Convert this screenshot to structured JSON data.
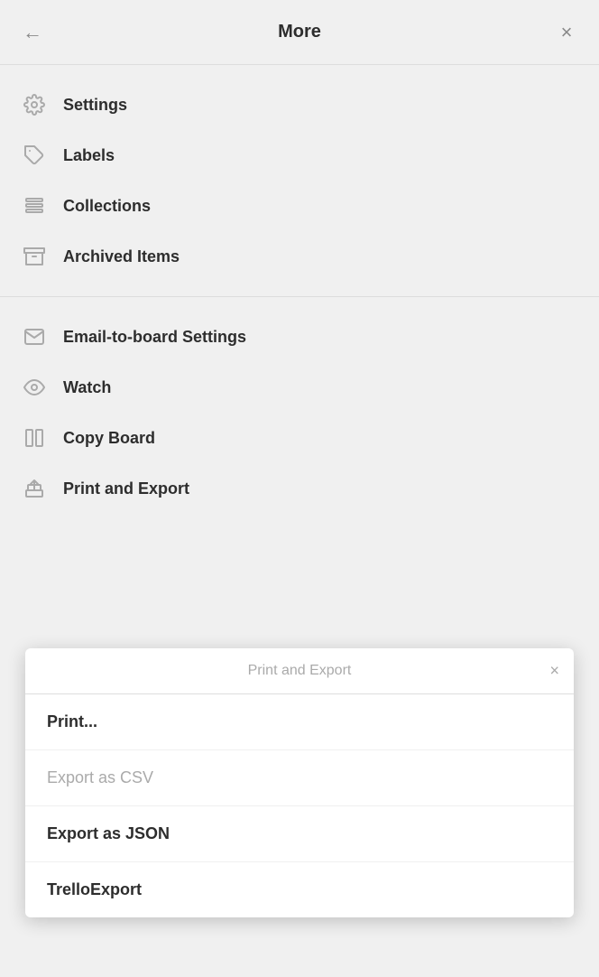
{
  "header": {
    "back_label": "←",
    "title": "More",
    "close_label": "×"
  },
  "section1": {
    "items": [
      {
        "id": "settings",
        "label": "Settings",
        "icon": "gear-icon"
      },
      {
        "id": "labels",
        "label": "Labels",
        "icon": "label-icon"
      },
      {
        "id": "collections",
        "label": "Collections",
        "icon": "collections-icon"
      },
      {
        "id": "archived-items",
        "label": "Archived Items",
        "icon": "archive-icon"
      }
    ]
  },
  "section2": {
    "items": [
      {
        "id": "email-to-board",
        "label": "Email-to-board Settings",
        "icon": "email-icon"
      },
      {
        "id": "watch",
        "label": "Watch",
        "icon": "watch-icon"
      },
      {
        "id": "copy-board",
        "label": "Copy Board",
        "icon": "copy-board-icon"
      },
      {
        "id": "print-export",
        "label": "Print and Export",
        "icon": "print-icon"
      }
    ]
  },
  "popup": {
    "title": "Print and Export",
    "close_label": "×",
    "items": [
      {
        "id": "print",
        "label": "Print...",
        "disabled": false
      },
      {
        "id": "export-csv",
        "label": "Export as CSV",
        "disabled": true
      },
      {
        "id": "export-json",
        "label": "Export as JSON",
        "disabled": false
      },
      {
        "id": "trello-export",
        "label": "TrelloExport",
        "disabled": false
      }
    ]
  }
}
